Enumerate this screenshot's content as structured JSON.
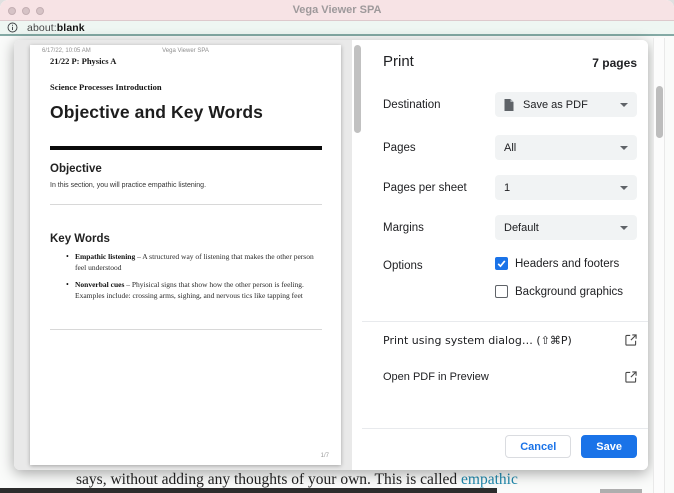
{
  "window": {
    "title": "Vega Viewer SPA"
  },
  "address_bar": {
    "scheme": "about:",
    "path": "blank"
  },
  "print_panel": {
    "title": "Print",
    "page_count": "7 pages",
    "rows": [
      {
        "label": "Destination",
        "value": "Save as PDF"
      },
      {
        "label": "Pages",
        "value": "All"
      },
      {
        "label": "Pages per sheet",
        "value": "1"
      },
      {
        "label": "Margins",
        "value": "Default"
      }
    ],
    "options_label": "Options",
    "checkboxes": [
      {
        "label": "Headers and footers",
        "checked": true
      },
      {
        "label": "Background graphics",
        "checked": false
      }
    ],
    "system_dialog_link": "Print using system dialog… (⇧⌘P)",
    "open_preview_link": "Open PDF in Preview",
    "cancel_label": "Cancel",
    "save_label": "Save"
  },
  "preview": {
    "header_left": "6/17/22, 10:05 AM",
    "header_center": "Vega Viewer SPA",
    "course_title": "21/22 P: Physics A",
    "module_title": "Science Processes Introduction",
    "page_title": "Objective and Key Words",
    "objective_heading": "Objective",
    "objective_text": "In this section, you will practice empathic listening.",
    "keywords_heading": "Key Words",
    "bullets": [
      {
        "term": "Empathic listening",
        "definition": "– A structured way of listening that makes the other person feel understood"
      },
      {
        "term": "Nonverbal cues",
        "definition": "– Phyisical signs that show how the other person is feeling. Examples include: crossing arms, sighing, and nervous tics like tapping feet"
      }
    ],
    "page_number": "1/7"
  },
  "background_page": {
    "visible_text": "says, without adding any thoughts of your own. This is called ",
    "link_text": "empathic"
  },
  "colors": {
    "accent_blue": "#1a73e8",
    "link_teal": "#1e87ab",
    "titlebar_pink": "#f7e3e5"
  }
}
